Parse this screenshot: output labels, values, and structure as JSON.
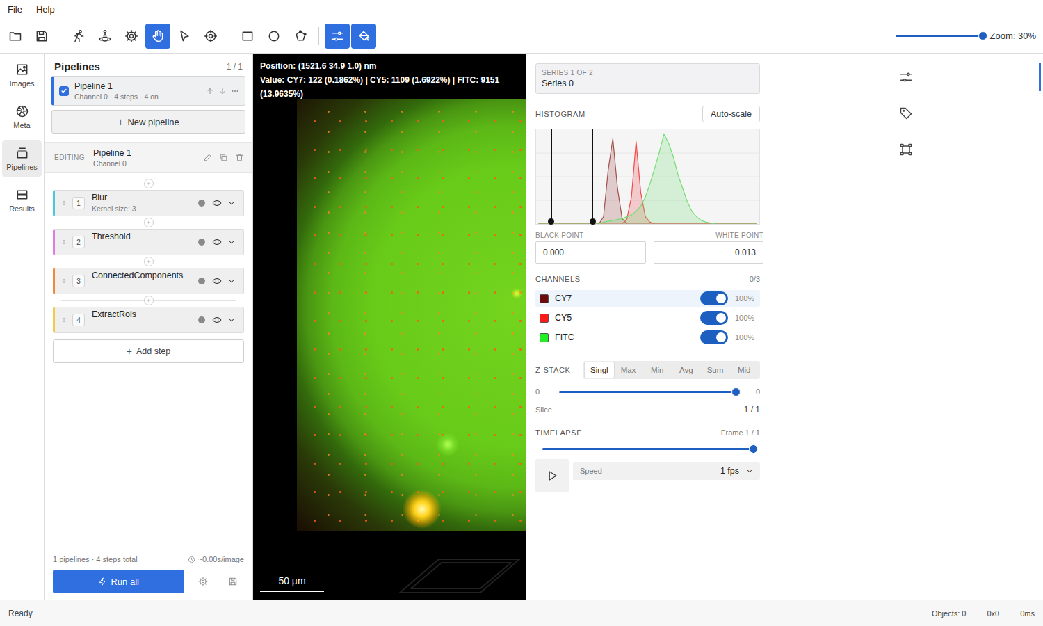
{
  "menu": [
    "File",
    "Help"
  ],
  "toolbar": {
    "tool_groups": [
      [
        {
          "selected": false
        },
        {
          "selected": false
        }
      ],
      [
        {
          "selected": false
        },
        {
          "selected": false
        },
        {
          "selected": false
        },
        {
          "selected": true
        },
        {
          "selected": false
        },
        {
          "selected": false
        }
      ],
      [
        {
          "selected": false
        },
        {
          "selected": false
        },
        {
          "selected": false
        }
      ],
      [
        {
          "selected": true
        },
        {
          "selected": true
        }
      ]
    ],
    "zoom": {
      "label": "Zoom: 30%",
      "level": 0.97
    }
  },
  "left_rail": [
    {
      "label": "Images",
      "selected": false
    },
    {
      "label": "Meta",
      "selected": false
    },
    {
      "label": "Pipelines",
      "selected": true
    },
    {
      "label": "Results",
      "selected": false
    }
  ],
  "pipelines_panel": {
    "title": "Pipelines",
    "count": "1 / 1",
    "pipelines": [
      {
        "name": "Pipeline 1",
        "summary": "Channel 0 · 4 steps · 4 on",
        "checked": true,
        "selected": true
      }
    ],
    "new_button": {
      "icon": "+",
      "label": "New pipeline"
    },
    "editing": {
      "label": "EDITING",
      "name": "Pipeline 1",
      "channel": "Channel 0"
    },
    "steps": [
      {
        "number": "1",
        "name": "Blur",
        "detail": "Kernel size: 3",
        "color": "#4cc6dc"
      },
      {
        "number": "2",
        "name": "Threshold",
        "color": "#e27be0"
      },
      {
        "number": "3",
        "name": "ConnectedComponents",
        "color": "#ef8a3a"
      },
      {
        "number": "4",
        "name": "ExtractRois",
        "color": "#f1cb45"
      }
    ],
    "add_step": {
      "icon": "+",
      "label": "Add step"
    },
    "footer": {
      "summary": "1 pipelines · 4 steps total",
      "timing": "~0.00s/image",
      "run_button": "Run all"
    }
  },
  "viewer": {
    "position": "Position: (1521.6 34.9 1.0) nm",
    "value": "Value: CY7: 122 (0.1862%) | CY5: 1109 (1.6922%) | FITC: 9151 (13.9635%)",
    "scale_bar": "50 µm"
  },
  "right_panel": {
    "series": {
      "label": "SERIES 1 OF 2",
      "value": "Series 0"
    },
    "histogram": {
      "title": "HISTOGRAM",
      "button": "Auto-scale",
      "series": [
        {
          "name": "CY7",
          "color": "#a0504a",
          "values": [
            0,
            0,
            0,
            0,
            0,
            0,
            0,
            0,
            0,
            0,
            0,
            0,
            0,
            0,
            8,
            60,
            95,
            40,
            6,
            0,
            0,
            0,
            0,
            0,
            0,
            0,
            0,
            0,
            0,
            0,
            0,
            0,
            0,
            0,
            0,
            0,
            0,
            0,
            0,
            0,
            0,
            0,
            0,
            0,
            0,
            0,
            0,
            0
          ]
        },
        {
          "name": "CY5",
          "color": "#f04a4a",
          "values": [
            0,
            0,
            0,
            0,
            0,
            0,
            0,
            0,
            0,
            0,
            0,
            0,
            0,
            0,
            0,
            0,
            0,
            0,
            0,
            5,
            30,
            92,
            35,
            8,
            2,
            0,
            0,
            0,
            0,
            0,
            0,
            0,
            0,
            0,
            0,
            0,
            0,
            0,
            0,
            0,
            0,
            0,
            0,
            0,
            0,
            0,
            0,
            0
          ]
        },
        {
          "name": "FITC",
          "color": "#74de74",
          "values": [
            0,
            0,
            0,
            0,
            0,
            0,
            0,
            0,
            0,
            0,
            0,
            0,
            0,
            0,
            2,
            3,
            4,
            5,
            6,
            8,
            10,
            14,
            20,
            30,
            45,
            62,
            80,
            100,
            90,
            75,
            55,
            40,
            25,
            14,
            8,
            4,
            2,
            1,
            0,
            0,
            0,
            0,
            0,
            0,
            0,
            0,
            0,
            0
          ]
        }
      ],
      "markers": [
        {
          "level": 0.068
        },
        {
          "level": 0.253
        }
      ],
      "black_point": {
        "label": "BLACK POINT",
        "value": "0.000"
      },
      "white_point": {
        "label": "WHITE POINT",
        "value": "0.013"
      }
    },
    "channels": {
      "title": "CHANNELS",
      "count": "0/3",
      "items": [
        {
          "name": "CY7",
          "color": "#6a0a0a",
          "on": true,
          "opacity": "100%",
          "selected": true
        },
        {
          "name": "CY5",
          "color": "#ff1a1a",
          "on": true,
          "opacity": "100%",
          "selected": false
        },
        {
          "name": "FITC",
          "color": "#22f022",
          "on": true,
          "opacity": "100%",
          "selected": false
        }
      ]
    },
    "z_stack": {
      "title": "Z-STACK",
      "modes": [
        {
          "label": "Singl",
          "selected": true
        },
        {
          "label": "Max",
          "selected": false
        },
        {
          "label": "Min",
          "selected": false
        },
        {
          "label": "Avg",
          "selected": false
        },
        {
          "label": "Sum",
          "selected": false
        },
        {
          "label": "Mid",
          "selected": false
        }
      ],
      "slider": {
        "min": "0",
        "max": "0",
        "level": 1.0
      },
      "slice_label": "Slice",
      "slice_value": "1 / 1"
    },
    "timelapse": {
      "title": "TIMELAPSE",
      "frame": "Frame 1 / 1",
      "level": 1.0,
      "speed_label": "Speed",
      "speed_value": "1 fps"
    }
  },
  "right_rail": [
    {
      "selected": true
    },
    {
      "selected": false
    },
    {
      "selected": false
    }
  ],
  "status_bar": {
    "status": "Ready",
    "objects": "Objects: 0",
    "size": "0x0",
    "time": "0ms"
  }
}
